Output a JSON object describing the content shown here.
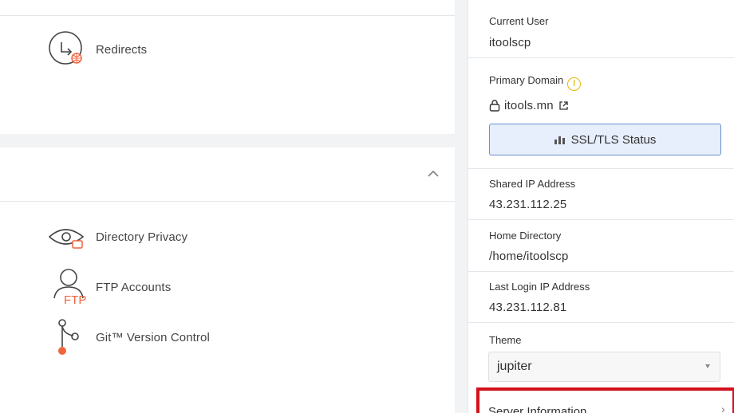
{
  "domains_section": {
    "tools": [
      {
        "label": "Redirects",
        "icon": "redirect-icon"
      }
    ]
  },
  "files_section": {
    "tools": [
      {
        "label": "Directory Privacy",
        "icon": "eye-folder-icon"
      },
      {
        "label": "FTP Accounts",
        "icon": "ftp-user-icon",
        "icon_text": "FTP"
      },
      {
        "label": "Git™ Version Control",
        "icon": "git-branch-icon"
      }
    ]
  },
  "sidebar": {
    "current_user": {
      "label": "Current User",
      "value": "itoolscp"
    },
    "primary_domain": {
      "label": "Primary Domain",
      "info_glyph": "!",
      "value": "itools.mn"
    },
    "ssl_button": {
      "label": "SSL/TLS Status"
    },
    "shared_ip": {
      "label": "Shared IP Address",
      "value": "43.231.112.25"
    },
    "home_dir": {
      "label": "Home Directory",
      "value": "/home/itoolscp"
    },
    "last_login": {
      "label": "Last Login IP Address",
      "value": "43.231.112.81"
    },
    "theme": {
      "label": "Theme",
      "value": "jupiter"
    },
    "server_info": {
      "label": "Server Information"
    }
  },
  "colors": {
    "accent_orange": "#f0643c",
    "highlight_red": "#d3111b",
    "warning_yellow": "#e6b800",
    "button_blue": "#6a8fcc"
  }
}
